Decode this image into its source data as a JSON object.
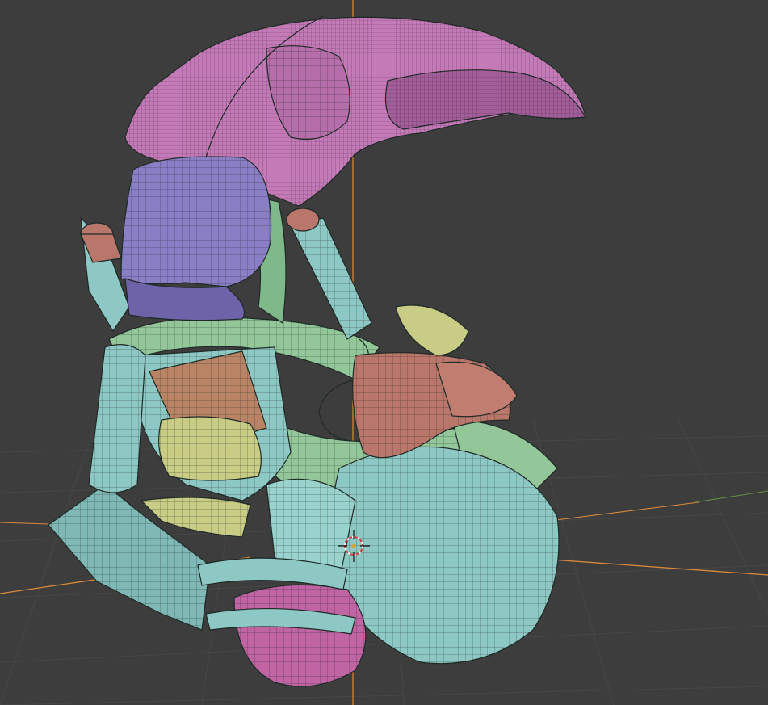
{
  "app": {
    "name": "",
    "view": "3D Viewport"
  },
  "viewport": {
    "background_color": "#3d3d3d",
    "grid_color": "#464646",
    "grid_visible": true,
    "axes": {
      "x_color": "#c9803a",
      "y_color": "#5f8f3f",
      "z_color": "#e08a2a"
    },
    "shading": "solid",
    "wireframe_overlay": true
  },
  "scene": {
    "object_parts": [
      {
        "name": "leaf-crest",
        "color": "#c57ab8"
      },
      {
        "name": "leaf-crest-dark",
        "color": "#a35e99"
      },
      {
        "name": "purple-block",
        "color": "#8a7ec4"
      },
      {
        "name": "teal-shell",
        "color": "#8ec8c4"
      },
      {
        "name": "green-straps",
        "color": "#93c79a"
      },
      {
        "name": "terracotta-pipes",
        "color": "#b9766a"
      },
      {
        "name": "olive-panels",
        "color": "#c8cc84"
      },
      {
        "name": "pink-base",
        "color": "#c064a4"
      },
      {
        "name": "brown-plate",
        "color": "#b98466"
      }
    ]
  },
  "cursor_3d": {
    "icon": "crosshair-3d-cursor"
  }
}
